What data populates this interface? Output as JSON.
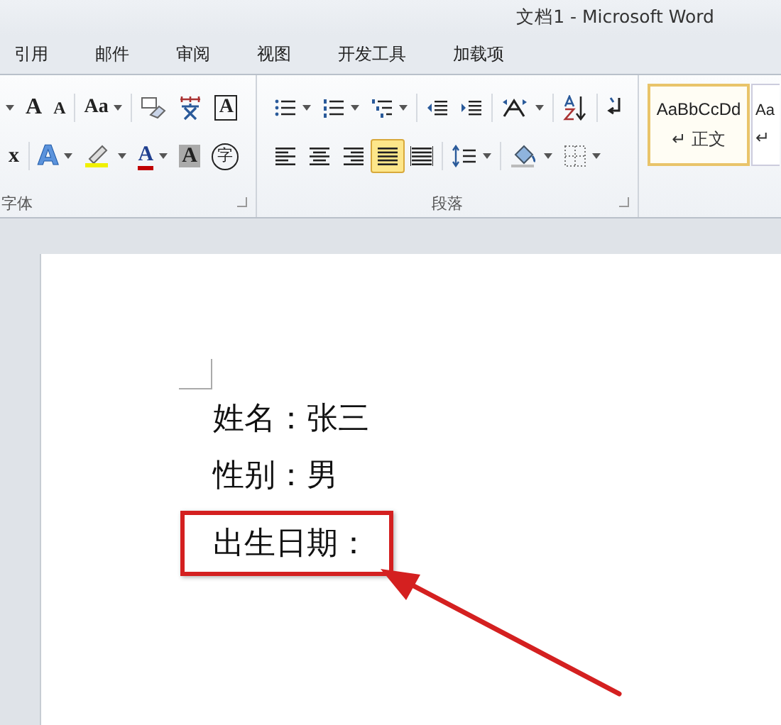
{
  "window": {
    "title": "文档1  -  Microsoft Word"
  },
  "tabs": [
    {
      "label": "引用",
      "selected": false
    },
    {
      "label": "邮件",
      "selected": false
    },
    {
      "label": "审阅",
      "selected": false
    },
    {
      "label": "视图",
      "selected": false
    },
    {
      "label": "开发工具",
      "selected": false
    },
    {
      "label": "加载项",
      "selected": false
    }
  ],
  "font_group": {
    "label": "字体",
    "row_1": [
      {
        "kind": "dropdown-edge"
      },
      {
        "kind": "grow",
        "label": "A"
      },
      {
        "kind": "shrink",
        "label": "A"
      },
      {
        "kind": "case",
        "label": "Aa"
      },
      {
        "kind": "clear"
      },
      {
        "kind": "phonetic"
      },
      {
        "kind": "border-char",
        "label": "A"
      }
    ],
    "row_2": [
      {
        "kind": "superscript",
        "label": "x"
      },
      {
        "kind": "effects",
        "label": "A"
      },
      {
        "kind": "highlight"
      },
      {
        "kind": "font-color",
        "label": "A"
      },
      {
        "kind": "shading-char",
        "label": "A"
      },
      {
        "kind": "enclose",
        "label": "字"
      }
    ]
  },
  "paragraph_group": {
    "label": "段落",
    "row_1": [
      {
        "kind": "bullets"
      },
      {
        "kind": "numbering"
      },
      {
        "kind": "multilevel"
      },
      {
        "kind": "outdent"
      },
      {
        "kind": "indent"
      },
      {
        "kind": "direction"
      },
      {
        "kind": "sort"
      },
      {
        "kind": "marks"
      }
    ],
    "alignment": [
      {
        "kind": "left",
        "selected": false
      },
      {
        "kind": "center",
        "selected": false
      },
      {
        "kind": "right",
        "selected": false
      },
      {
        "kind": "justify",
        "selected": true
      },
      {
        "kind": "distributed",
        "selected": false
      }
    ],
    "row_2": [
      {
        "kind": "spacing"
      },
      {
        "kind": "fill"
      },
      {
        "kind": "borders"
      }
    ]
  },
  "styles": [
    {
      "sample": "AaBbCcDd",
      "name": "↵ 正文",
      "selected": true
    },
    {
      "sample": "Aa",
      "name": "↵",
      "selected": false
    }
  ],
  "document": {
    "lines": [
      {
        "text": "姓名：张三",
        "highlighted": false
      },
      {
        "text": "性别：男",
        "highlighted": false
      },
      {
        "text": "出生日期：",
        "highlighted": true
      }
    ]
  }
}
